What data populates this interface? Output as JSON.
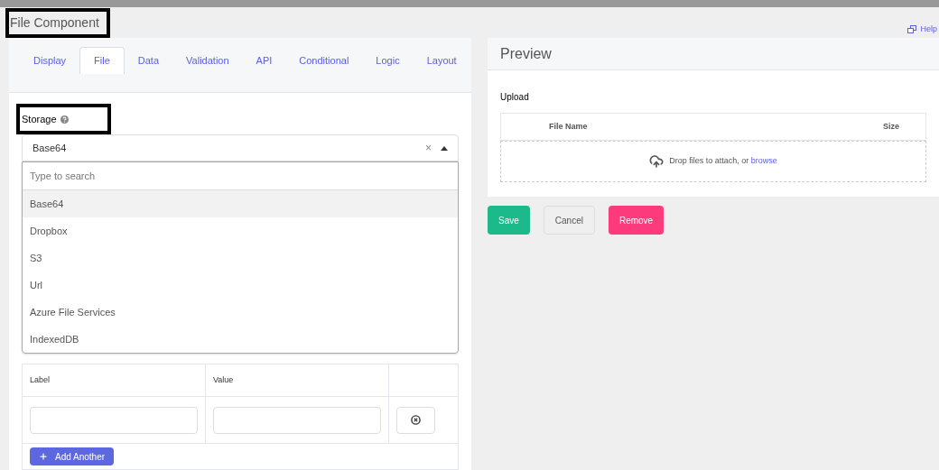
{
  "title": "File Component",
  "help": "Help",
  "tabs": [
    {
      "label": "Display",
      "selected": false
    },
    {
      "label": "File",
      "selected": true
    },
    {
      "label": "Data",
      "selected": false
    },
    {
      "label": "Validation",
      "selected": false
    },
    {
      "label": "API",
      "selected": false
    },
    {
      "label": "Conditional",
      "selected": false
    },
    {
      "label": "Logic",
      "selected": false
    },
    {
      "label": "Layout",
      "selected": false
    }
  ],
  "storage": {
    "label": "Storage",
    "value": "Base64",
    "clear": "×",
    "search_placeholder": "Type to search",
    "options": [
      {
        "label": "Base64",
        "selected": true
      },
      {
        "label": "Dropbox",
        "selected": false
      },
      {
        "label": "S3",
        "selected": false
      },
      {
        "label": "Url",
        "selected": false
      },
      {
        "label": "Azure File Services",
        "selected": false
      },
      {
        "label": "IndexedDB",
        "selected": false
      }
    ]
  },
  "datagrid": {
    "columns": [
      "Label",
      "Value"
    ],
    "add_button": "Add Another"
  },
  "preview": {
    "title": "Preview",
    "upload_label": "Upload",
    "columns": [
      "File Name",
      "Size"
    ],
    "drop_text": "Drop files to attach, or ",
    "browse": "browse"
  },
  "buttons": [
    {
      "label": "Save",
      "kind": "success"
    },
    {
      "label": "Cancel",
      "kind": "secondary"
    },
    {
      "label": "Remove",
      "kind": "danger"
    }
  ]
}
